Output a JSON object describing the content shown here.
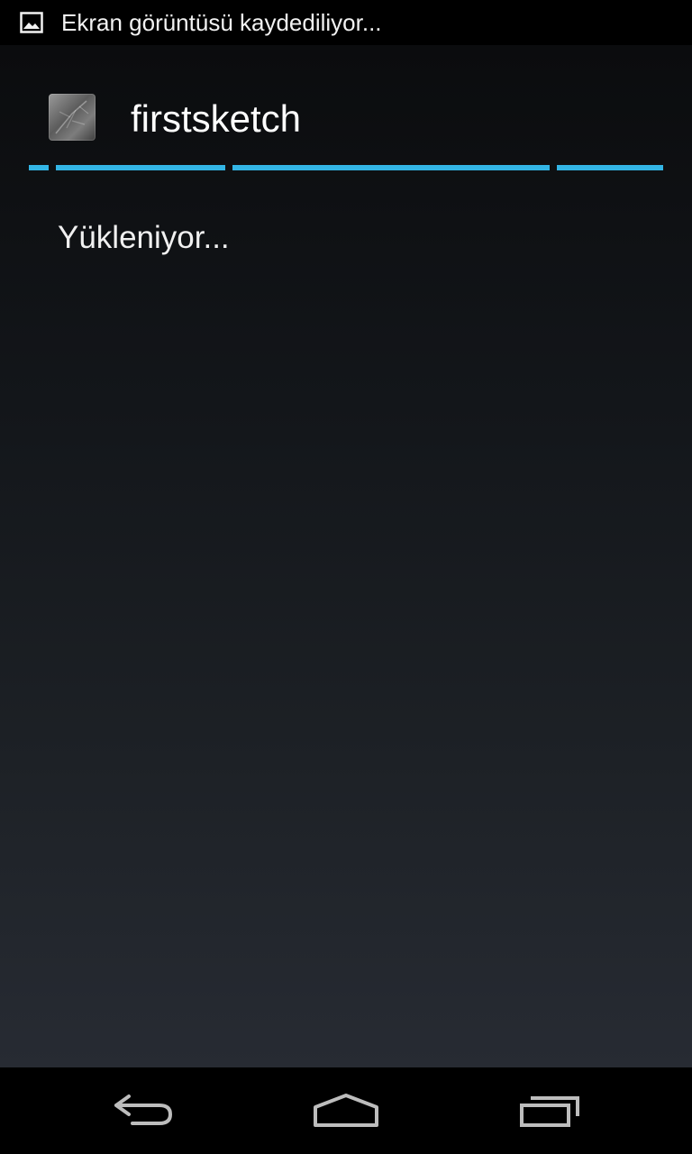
{
  "status_bar": {
    "notification_icon": "image-icon",
    "notification_text": "Ekran görüntüsü kaydediliyor..."
  },
  "dialog": {
    "app_icon": "sketch-app-icon",
    "title": "firstsketch",
    "message": "Yükleniyor...",
    "accent_color": "#33b5e5"
  },
  "nav_bar": {
    "back_icon": "back-icon",
    "home_icon": "home-icon",
    "recents_icon": "recent-apps-icon"
  }
}
